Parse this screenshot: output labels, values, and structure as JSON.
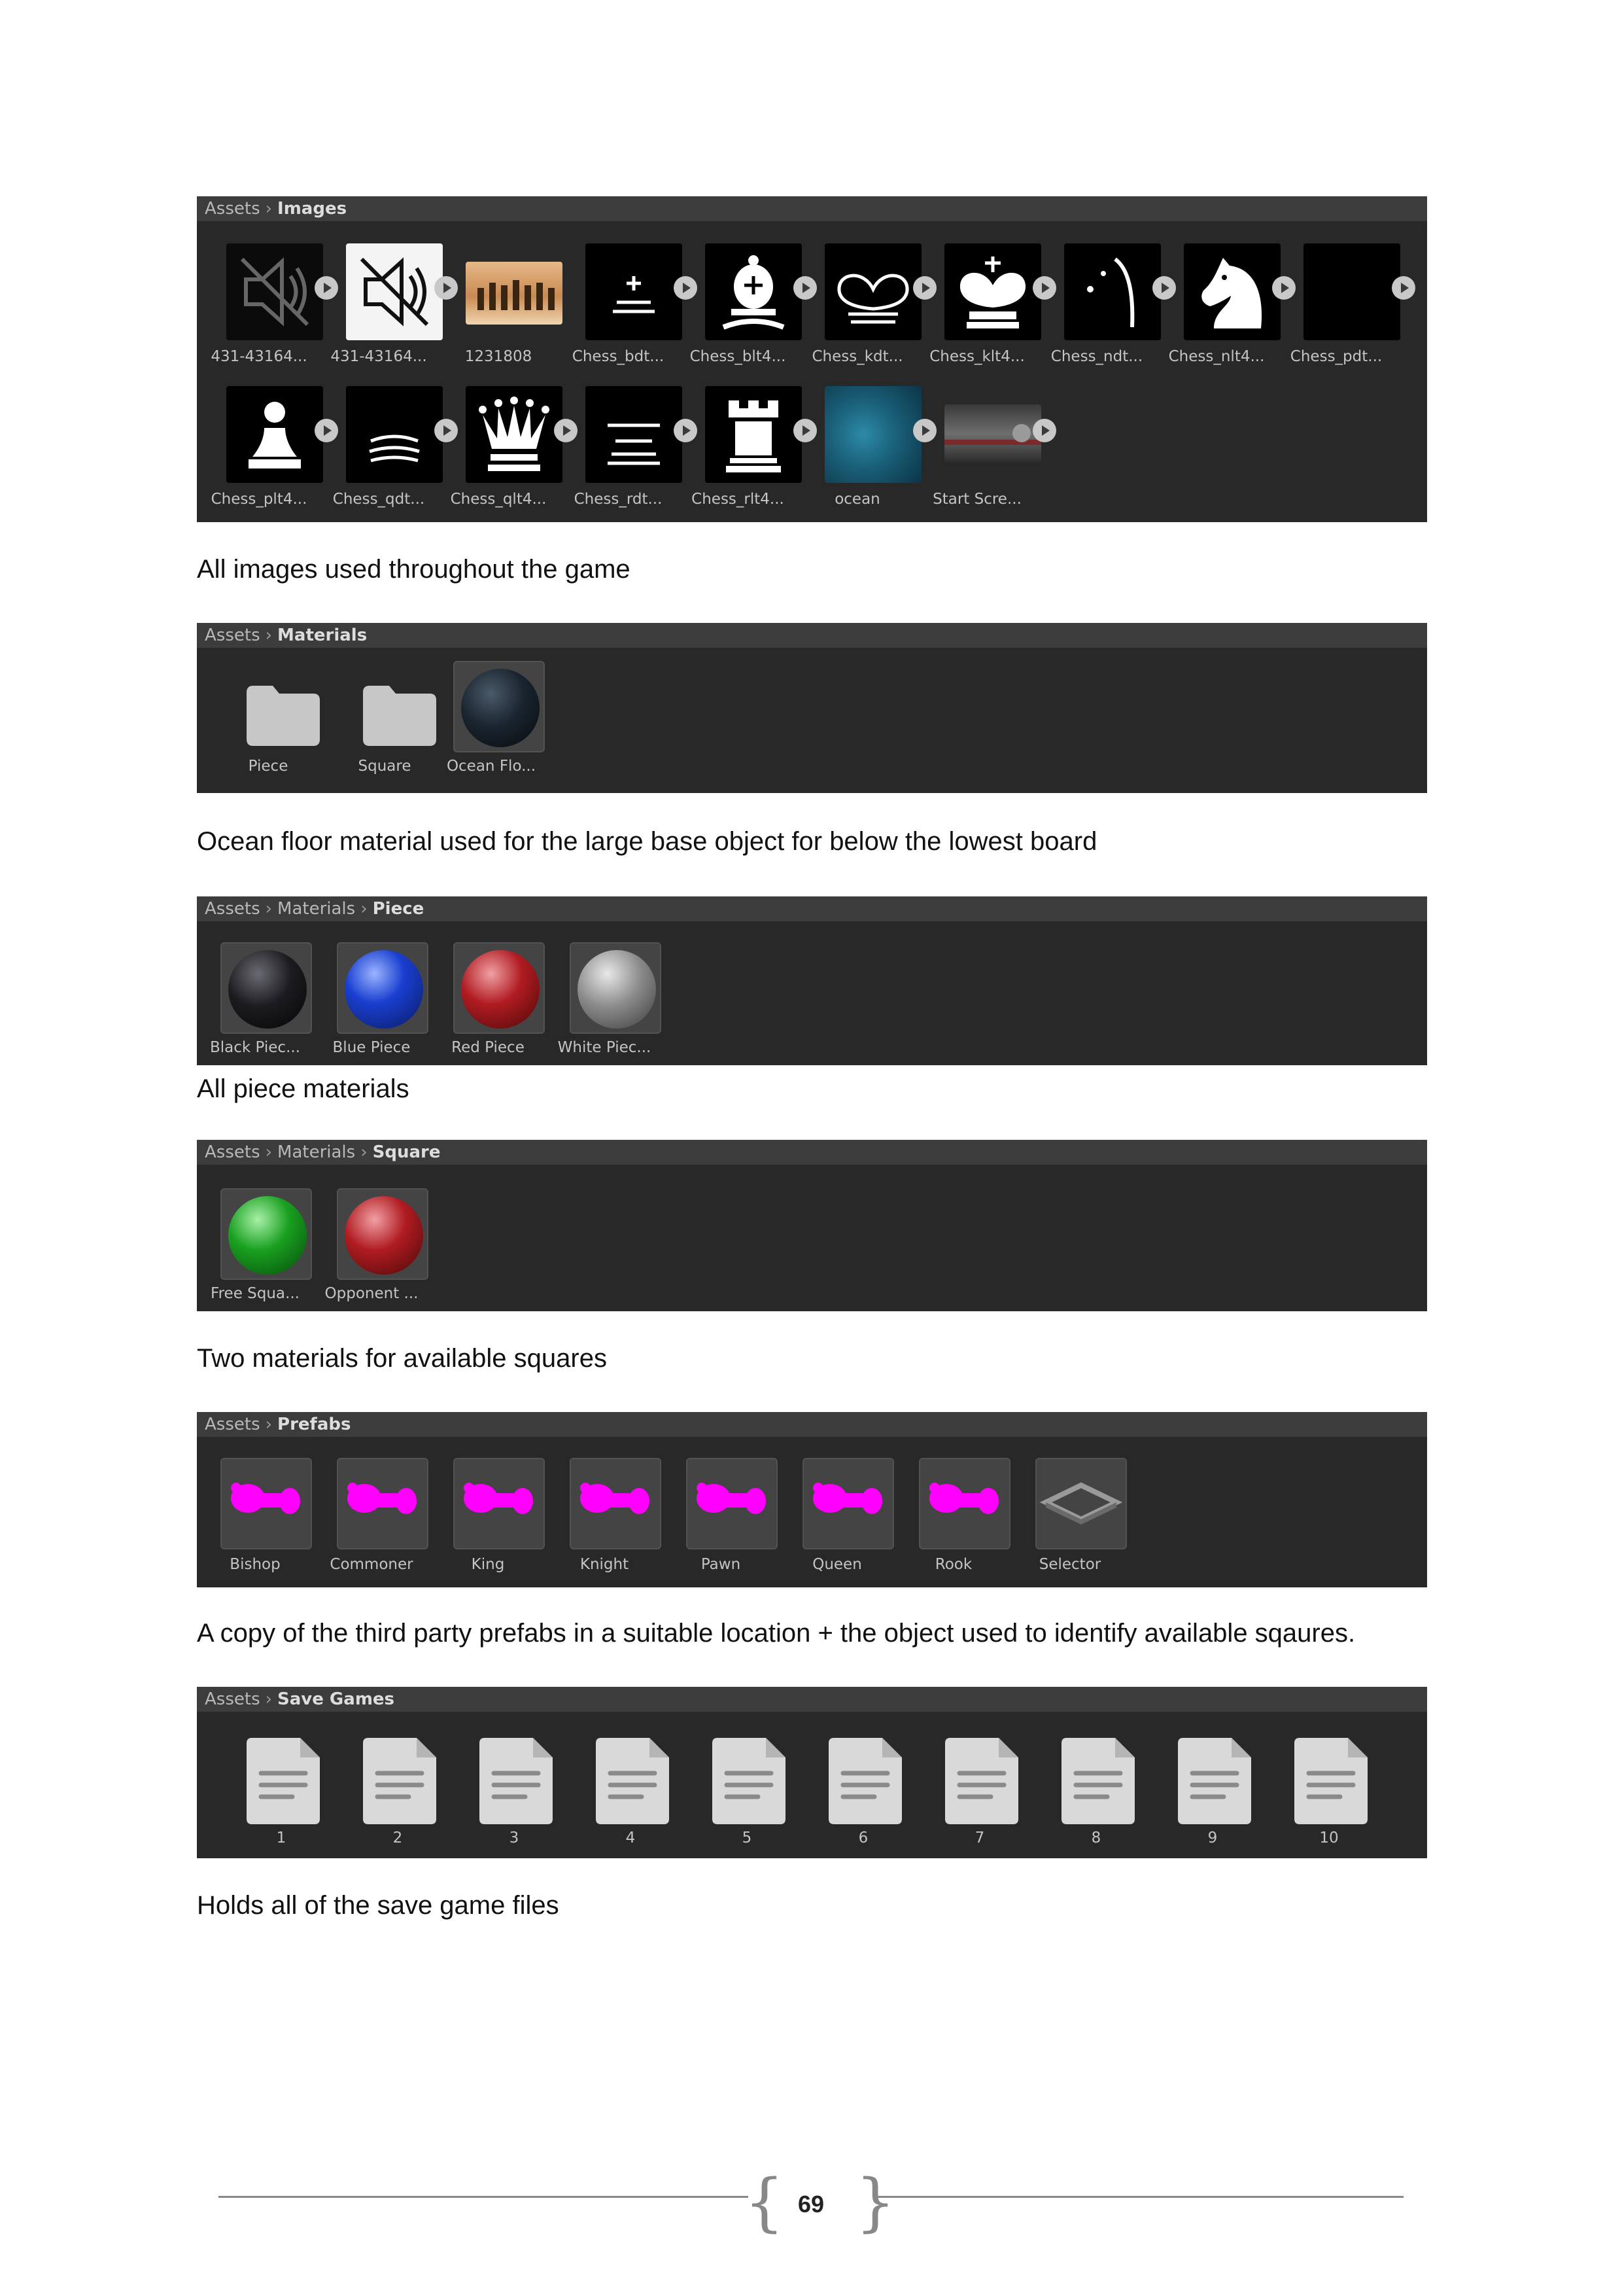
{
  "images_panel": {
    "breadcrumb": [
      "Assets",
      "Images"
    ],
    "items": [
      {
        "label": "431-43164...",
        "icon": "mute-icon-dark"
      },
      {
        "label": "431-43164...",
        "icon": "mute-icon-light"
      },
      {
        "label": "1231808",
        "icon": "chess-photo"
      },
      {
        "label": "Chess_bdt...",
        "icon": "bishop-dark"
      },
      {
        "label": "Chess_blt4...",
        "icon": "bishop-light"
      },
      {
        "label": "Chess_kdt...",
        "icon": "king-dark"
      },
      {
        "label": "Chess_klt4...",
        "icon": "king-light"
      },
      {
        "label": "Chess_ndt...",
        "icon": "knight-dark"
      },
      {
        "label": "Chess_nlt4...",
        "icon": "knight-light"
      },
      {
        "label": "Chess_pdt...",
        "icon": "pawn-dark"
      },
      {
        "label": "Chess_plt4...",
        "icon": "pawn-light"
      },
      {
        "label": "Chess_qdt...",
        "icon": "queen-dark"
      },
      {
        "label": "Chess_qlt4...",
        "icon": "queen-light"
      },
      {
        "label": "Chess_rdt...",
        "icon": "rook-dark"
      },
      {
        "label": "Chess_rlt4...",
        "icon": "rook-light"
      },
      {
        "label": "ocean",
        "icon": "ocean-photo"
      },
      {
        "label": "Start Scre...",
        "icon": "start-screen-photo"
      }
    ]
  },
  "caption_images": "All images used throughout the game",
  "materials_panel": {
    "breadcrumb": [
      "Assets",
      "Materials"
    ],
    "items": [
      {
        "label": "Piece",
        "icon": "folder-icon"
      },
      {
        "label": "Square",
        "icon": "folder-icon"
      },
      {
        "label": "Ocean Flo...",
        "icon": "sphere",
        "color": "#1a2530"
      }
    ]
  },
  "caption_materials": "Ocean floor material used for the large base object for below the lowest board",
  "piece_panel": {
    "breadcrumb": [
      "Assets",
      "Materials",
      "Piece"
    ],
    "items": [
      {
        "label": "Black Piec...",
        "color": "#1c1c20"
      },
      {
        "label": "Blue Piece",
        "color": "#1a3fd0"
      },
      {
        "label": "Red Piece",
        "color": "#b01c22"
      },
      {
        "label": "White Piec...",
        "color": "#8c8c8c"
      }
    ]
  },
  "caption_piece": "All piece materials",
  "square_panel": {
    "breadcrumb": [
      "Assets",
      "Materials",
      "Square"
    ],
    "items": [
      {
        "label": "Free Squa...",
        "color": "#1aa021"
      },
      {
        "label": "Opponent ...",
        "color": "#b01c22"
      }
    ]
  },
  "caption_square": "Two materials for available squares",
  "prefabs_panel": {
    "breadcrumb": [
      "Assets",
      "Prefabs"
    ],
    "items": [
      {
        "label": "Bishop",
        "icon": "magenta-piece"
      },
      {
        "label": "Commoner",
        "icon": "magenta-piece"
      },
      {
        "label": "King",
        "icon": "magenta-piece"
      },
      {
        "label": "Knight",
        "icon": "magenta-piece"
      },
      {
        "label": "Pawn",
        "icon": "magenta-piece"
      },
      {
        "label": "Queen",
        "icon": "magenta-piece"
      },
      {
        "label": "Rook",
        "icon": "magenta-piece"
      },
      {
        "label": "Selector",
        "icon": "selector-frame"
      }
    ]
  },
  "caption_prefabs": "A copy of the third party prefabs in a suitable location + the object used to identify available sqaures.",
  "saves_panel": {
    "breadcrumb": [
      "Assets",
      "Save Games"
    ],
    "items": [
      {
        "label": "1"
      },
      {
        "label": "2"
      },
      {
        "label": "3"
      },
      {
        "label": "4"
      },
      {
        "label": "5"
      },
      {
        "label": "6"
      },
      {
        "label": "7"
      },
      {
        "label": "8"
      },
      {
        "label": "9"
      },
      {
        "label": "10"
      }
    ]
  },
  "caption_saves": "Holds all of the save game files",
  "page_number": "69",
  "colors": {
    "panel_bg": "#282828",
    "header_bg": "#3c3c3c",
    "magenta": "#ff00ff"
  }
}
